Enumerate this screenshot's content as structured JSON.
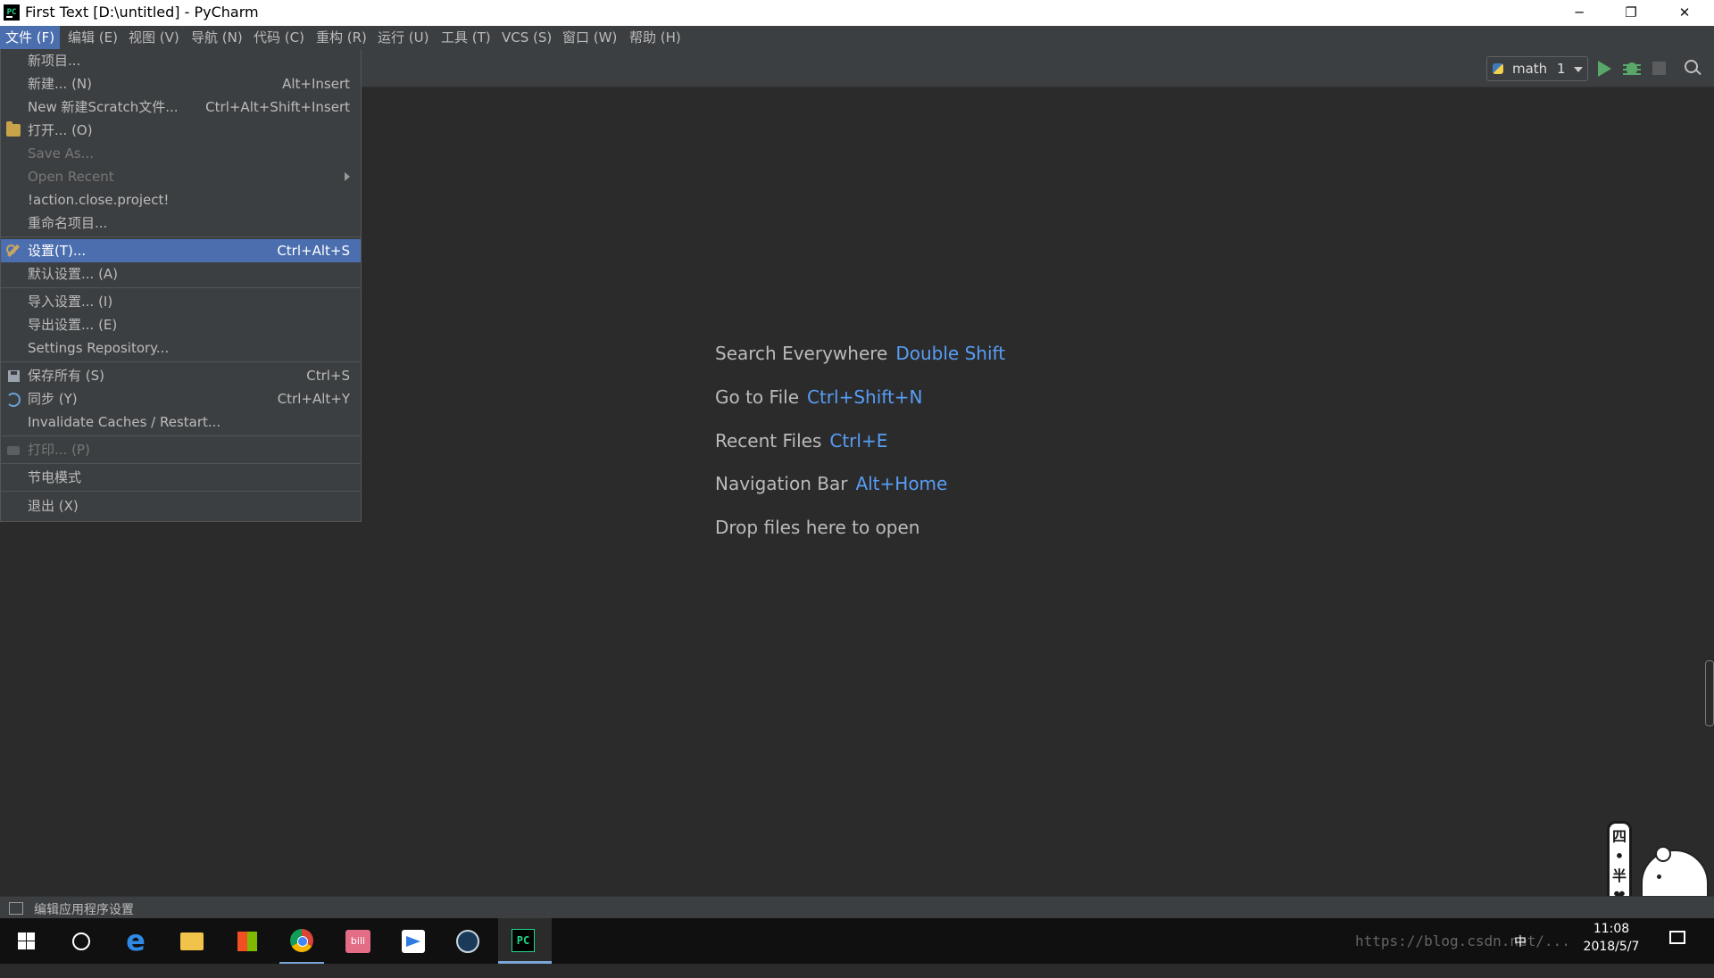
{
  "window": {
    "title": "First Text [D:\\untitled] - PyCharm",
    "app_icon_text": "PC",
    "controls": {
      "minimize": "─",
      "restore": "❐",
      "close": "✕"
    }
  },
  "menubar": {
    "items": [
      {
        "label": "文件 (F)"
      },
      {
        "label": "编辑 (E)"
      },
      {
        "label": "视图 (V)"
      },
      {
        "label": "导航 (N)"
      },
      {
        "label": "代码 (C)"
      },
      {
        "label": "重构 (R)"
      },
      {
        "label": "运行 (U)"
      },
      {
        "label": "工具 (T)"
      },
      {
        "label": "VCS (S)"
      },
      {
        "label": "窗口 (W)"
      },
      {
        "label": "帮助 (H)"
      }
    ]
  },
  "toolbar": {
    "run_config": {
      "name": "math",
      "number": "1"
    }
  },
  "file_menu": {
    "items": [
      {
        "label": "新项目...",
        "shortcut": ""
      },
      {
        "label": "新建... (N)",
        "shortcut": "Alt+Insert"
      },
      {
        "label": "New 新建Scratch文件...",
        "shortcut": "Ctrl+Alt+Shift+Insert"
      },
      {
        "label": "打开... (O)",
        "shortcut": "",
        "icon": "folder-icon"
      },
      {
        "label": "Save As...",
        "shortcut": "",
        "disabled": true
      },
      {
        "label": "Open Recent",
        "shortcut": "",
        "disabled": true,
        "submenu": true
      },
      {
        "label": "!action.close.project!",
        "shortcut": ""
      },
      {
        "label": "重命名项目...",
        "shortcut": ""
      },
      {
        "label": "设置(T)...",
        "shortcut": "Ctrl+Alt+S",
        "icon": "wrench-icon",
        "selected": true
      },
      {
        "label": "默认设置... (A)",
        "shortcut": ""
      },
      {
        "label": "导入设置... (I)",
        "shortcut": ""
      },
      {
        "label": "导出设置... (E)",
        "shortcut": ""
      },
      {
        "label": "Settings Repository...",
        "shortcut": ""
      },
      {
        "label": "保存所有 (S)",
        "shortcut": "Ctrl+S",
        "icon": "save-icon"
      },
      {
        "label": "同步 (Y)",
        "shortcut": "Ctrl+Alt+Y",
        "icon": "sync-icon"
      },
      {
        "label": "Invalidate Caches / Restart...",
        "shortcut": ""
      },
      {
        "label": "打印... (P)",
        "shortcut": "",
        "disabled": true,
        "icon": "print-icon"
      },
      {
        "label": "节电模式",
        "shortcut": ""
      },
      {
        "label": "退出 (X)",
        "shortcut": ""
      }
    ]
  },
  "welcome_hints": [
    {
      "text": "Search Everywhere",
      "key": "Double Shift"
    },
    {
      "text": "Go to File",
      "key": "Ctrl+Shift+N"
    },
    {
      "text": "Recent Files",
      "key": "Ctrl+E"
    },
    {
      "text": "Navigation Bar",
      "key": "Alt+Home"
    },
    {
      "text": "Drop files here to open",
      "key": ""
    }
  ],
  "statusbar": {
    "message": "编辑应用程序设置"
  },
  "taskbar": {
    "watermark": "https://blog.csdn.net/...",
    "tray": {
      "ime": "中",
      "time": "11:08",
      "date": "2018/5/7"
    },
    "bili_text": "bili",
    "mascot_text": "四•半❤"
  },
  "colors": {
    "editor_bg": "#2b2b2b",
    "menu_bg": "#3c3f41",
    "selection": "#4b6eaf",
    "hint_key": "#589df6",
    "run_green": "#59a869"
  }
}
